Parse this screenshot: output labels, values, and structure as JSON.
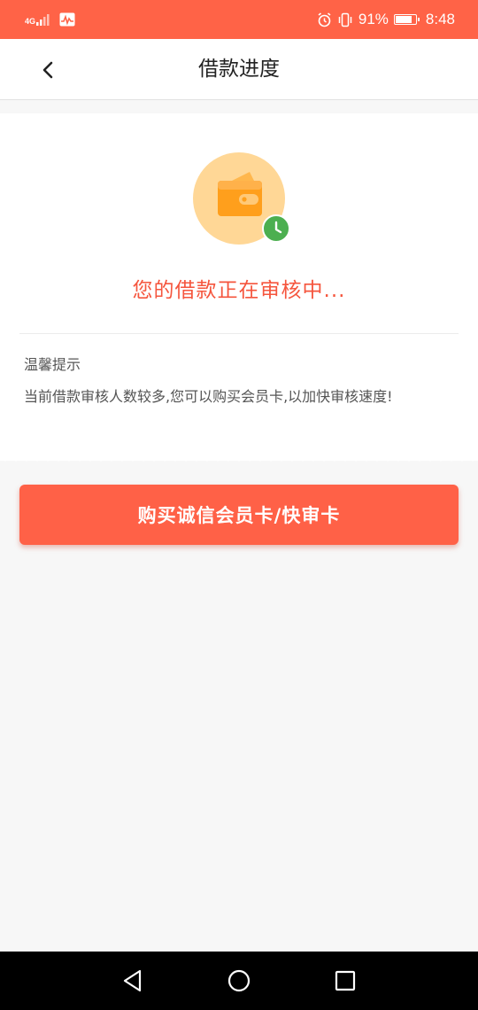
{
  "status_bar": {
    "network": "4G",
    "battery": "91%",
    "battery_level": 0.91,
    "time": "8:48"
  },
  "header": {
    "title": "借款进度",
    "back_icon": "chevron-left-icon"
  },
  "status": {
    "message": "您的借款正在审核中...",
    "icon": "wallet-icon",
    "badge_icon": "clock-icon"
  },
  "tip": {
    "title": "温馨提示",
    "text": "当前借款审核人数较多,您可以购买会员卡,以加快审核速度!"
  },
  "action": {
    "button_label": "购买诚信会员卡/快审卡"
  },
  "nav": {
    "icons": [
      "back-triangle-icon",
      "home-circle-icon",
      "recent-square-icon"
    ]
  },
  "colors": {
    "accent": "#ff6347",
    "status_text": "#f5553d",
    "wallet": "#ffa726",
    "wallet_bg": "#ffd796",
    "clock_badge": "#4caf50"
  }
}
